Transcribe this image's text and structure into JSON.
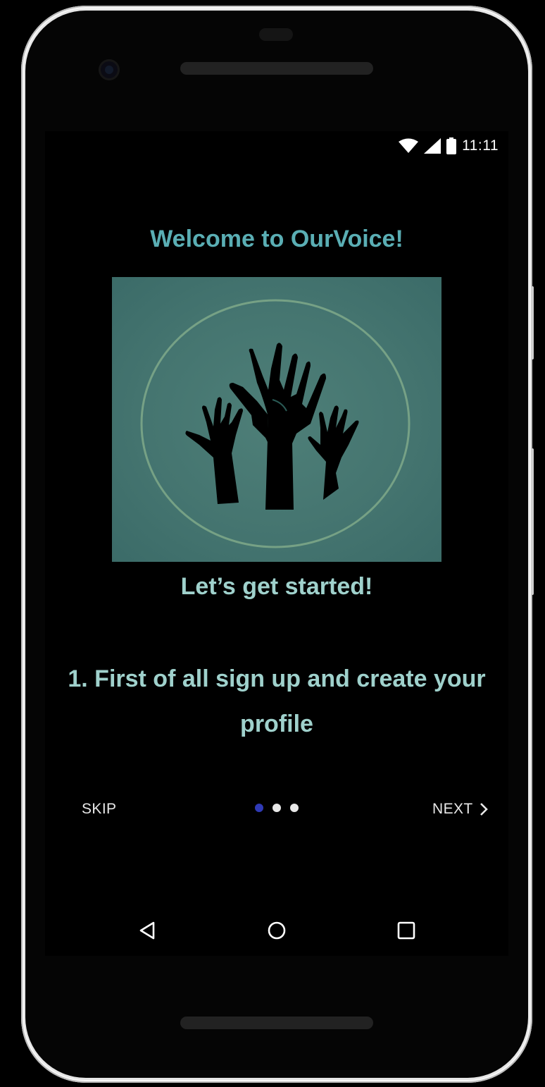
{
  "status_bar": {
    "time": "11:11",
    "icons": [
      "wifi-icon",
      "signal-icon",
      "battery-icon"
    ]
  },
  "onboarding": {
    "welcome_title": "Welcome to OurVoice!",
    "image": "raised-hands-illustration",
    "subtitle": "Let’s get started!",
    "step_text": "1. First of all sign up and create your profile",
    "skip_label": "SKIP",
    "next_label": "NEXT",
    "page_indicator": {
      "total": 3,
      "current": 1
    }
  },
  "nav_bar": {
    "buttons": [
      "back-icon",
      "home-icon",
      "recents-icon"
    ]
  },
  "colors": {
    "title": "#5aaeb4",
    "body_text": "#9fd1cc",
    "hero_bg": "#457570",
    "active_dot": "#2f3ab6",
    "screen_bg": "#000000"
  }
}
